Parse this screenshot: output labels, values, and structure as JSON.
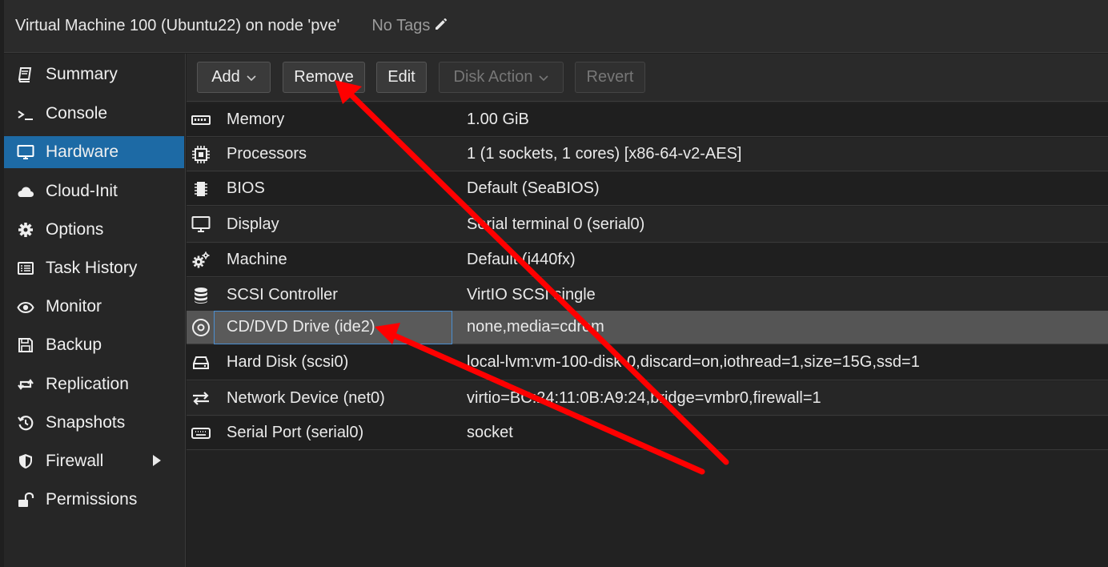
{
  "header": {
    "title": "Virtual Machine 100 (Ubuntu22) on node 'pve'",
    "tags_label": "No Tags",
    "tags_icon": "pencil-icon"
  },
  "sidebar": {
    "items": [
      {
        "label": "Summary",
        "icon": "book-icon",
        "active": false
      },
      {
        "label": "Console",
        "icon": "terminal-icon",
        "active": false
      },
      {
        "label": "Hardware",
        "icon": "monitor-icon",
        "active": true
      },
      {
        "label": "Cloud-Init",
        "icon": "cloud-icon",
        "active": false
      },
      {
        "label": "Options",
        "icon": "gear-icon",
        "active": false
      },
      {
        "label": "Task History",
        "icon": "list-icon",
        "active": false
      },
      {
        "label": "Monitor",
        "icon": "eye-icon",
        "active": false
      },
      {
        "label": "Backup",
        "icon": "floppy-icon",
        "active": false
      },
      {
        "label": "Replication",
        "icon": "retweet-icon",
        "active": false
      },
      {
        "label": "Snapshots",
        "icon": "history-icon",
        "active": false
      },
      {
        "label": "Firewall",
        "icon": "shield-icon",
        "active": false
      },
      {
        "label": "Permissions",
        "icon": "unlock-icon",
        "active": false
      }
    ]
  },
  "toolbar": {
    "add_label": "Add",
    "remove_label": "Remove",
    "edit_label": "Edit",
    "disk_action_label": "Disk Action",
    "revert_label": "Revert"
  },
  "hardware": {
    "rows": [
      {
        "name": "Memory",
        "value": "1.00 GiB",
        "icon": "memory-icon"
      },
      {
        "name": "Processors",
        "value": "1 (1 sockets, 1 cores) [x86-64-v2-AES]",
        "icon": "cpu-icon"
      },
      {
        "name": "BIOS",
        "value": "Default (SeaBIOS)",
        "icon": "chip-icon"
      },
      {
        "name": "Display",
        "value": "Serial terminal 0 (serial0)",
        "icon": "desktop-icon"
      },
      {
        "name": "Machine",
        "value": "Default (i440fx)",
        "icon": "cogs-icon"
      },
      {
        "name": "SCSI Controller",
        "value": "VirtIO SCSI single",
        "icon": "database-icon"
      },
      {
        "name": "CD/DVD Drive (ide2)",
        "value": "none,media=cdrom",
        "icon": "cdrom-icon",
        "selected": true
      },
      {
        "name": "Hard Disk (scsi0)",
        "value": "local-lvm:vm-100-disk-0,discard=on,iothread=1,size=15G,ssd=1",
        "icon": "hdd-icon"
      },
      {
        "name": "Network Device (net0)",
        "value": "virtio=BC:24:11:0B:A9:24,bridge=vmbr0,firewall=1",
        "icon": "exchange-icon"
      },
      {
        "name": "Serial Port (serial0)",
        "value": "socket",
        "icon": "keyboard-icon"
      }
    ]
  },
  "colors": {
    "accent": "#1d6aa5",
    "annotation_arrow": "#ff0000"
  }
}
